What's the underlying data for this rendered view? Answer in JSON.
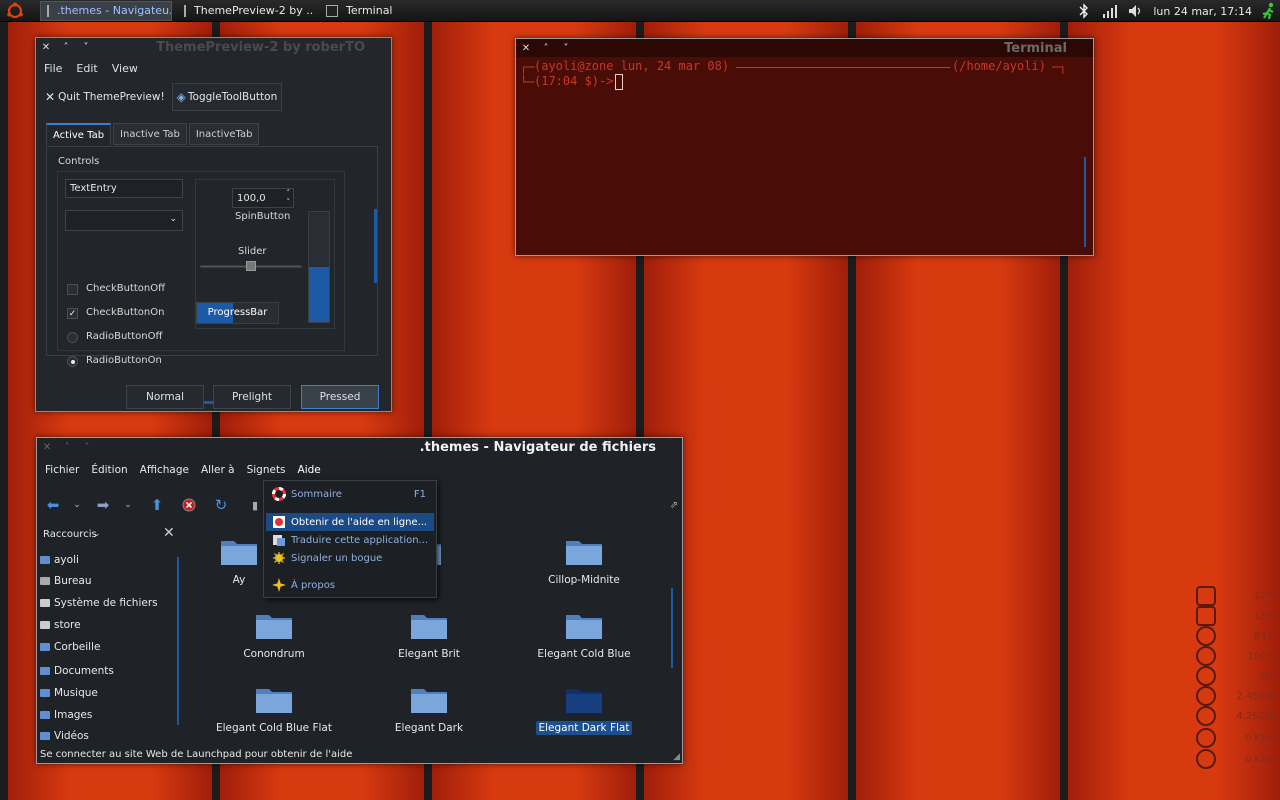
{
  "panel": {
    "tasks": [
      {
        "label": ".themes - Navigateu...",
        "active": true
      },
      {
        "label": "ThemePreview-2 by ...",
        "active": false
      },
      {
        "label": "Terminal",
        "active": false
      }
    ],
    "clock": "lun 24 mar, 17:14"
  },
  "theme_preview": {
    "title": "ThemePreview-2 by roberTO",
    "menu": [
      "File",
      "Edit",
      "View"
    ],
    "toolbar": {
      "quit": "Quit ThemePreview!",
      "toggle": "ToggleToolButton"
    },
    "tabs": [
      "Active Tab",
      "Inactive Tab",
      "InactiveTab"
    ],
    "controls_label": "Controls",
    "text_entry": "TextEntry",
    "checks": [
      "CheckButtonOff",
      "CheckButtonOn",
      "RadioButtonOff",
      "RadioButtonOn"
    ],
    "spin_value": "100,0",
    "spin_label": "SpinButton",
    "slider_label": "Slider",
    "slider_level": 0.5,
    "progress_label": "ProgressBar",
    "progress_level": 0.45,
    "vbar_level": 0.5,
    "buttons": [
      "Normal",
      "Prelight",
      "Pressed"
    ]
  },
  "terminal": {
    "title": "Terminal",
    "line1_user": "(ayoli@zone lun, 24 mar 08)",
    "line1_dir": "(/home/ayoli)",
    "line2": "(17:04 $)->"
  },
  "file_manager": {
    "title": ".themes - Navigateur de fichiers",
    "menu": [
      "Fichier",
      "Édition",
      "Affichage",
      "Aller à",
      "Signets",
      "Aide"
    ],
    "sidebar_header": "Raccourcis",
    "sidebar_items": [
      "ayoli",
      "Bureau",
      "Système de fichiers",
      "store",
      "Corbeille",
      "Documents",
      "Musique",
      "Images",
      "Vidéos"
    ],
    "files": [
      {
        "name": "Ay",
        "selected": false
      },
      {
        "name": "hite",
        "selected": false
      },
      {
        "name": "Cillop-Midnite",
        "selected": false
      },
      {
        "name": "Conondrum",
        "selected": false
      },
      {
        "name": "Elegant Brit",
        "selected": false
      },
      {
        "name": "Elegant Cold Blue",
        "selected": false
      },
      {
        "name": "Elegant Cold Blue Flat",
        "selected": false
      },
      {
        "name": "Elegant Dark",
        "selected": false
      },
      {
        "name": "Elegant Dark Flat",
        "selected": true
      }
    ],
    "status": "Se connecter au site Web de Launchpad pour obtenir de l'aide"
  },
  "help_menu": {
    "items": [
      {
        "label": "Sommaire",
        "accel": "F1",
        "icon": "lifebuoy-icon",
        "highlighted": false
      },
      {
        "label": "Obtenir de l'aide en ligne...",
        "accel": "",
        "icon": "help-online-icon",
        "highlighted": true
      },
      {
        "label": "Traduire cette application...",
        "accel": "",
        "icon": "translate-icon",
        "highlighted": false
      },
      {
        "label": "Signaler un bogue",
        "accel": "",
        "icon": "bug-icon",
        "highlighted": false
      },
      {
        "label": "À propos",
        "accel": "",
        "icon": "star-icon",
        "highlighted": false
      }
    ]
  },
  "conky": {
    "values": [
      "12%",
      "13%",
      "84%",
      "100%",
      "5%",
      "2.45GiB",
      "4.26GiB",
      "0 Kb/s",
      "0 Kb/s"
    ]
  },
  "colors": {
    "accent": "#1b4f8f",
    "wallpaper_red": "#d83a10",
    "terminal_bg": "#4a0c06",
    "terminal_text": "#c23a2a"
  }
}
